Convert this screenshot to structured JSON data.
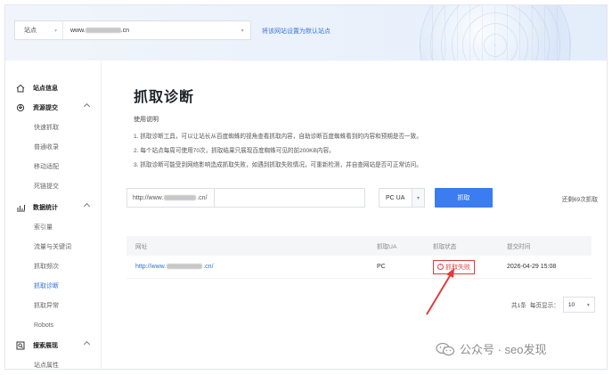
{
  "header": {
    "site_label": "站点",
    "site_url_prefix": "www.",
    "site_url_suffix": ".cn",
    "set_default_link": "将该网站设置为默认站点"
  },
  "sidebar": {
    "groups": [
      {
        "label": "站点信息",
        "icon": "home-icon",
        "items": []
      },
      {
        "label": "资源提交",
        "icon": "upload-icon",
        "items": [
          "快速抓取",
          "普通收录",
          "移动适配",
          "死链提交"
        ]
      },
      {
        "label": "数据统计",
        "icon": "chart-icon",
        "items": [
          "索引量",
          "流量与关键词",
          "抓取频次",
          "抓取诊断",
          "抓取异常",
          "Robots"
        ]
      },
      {
        "label": "搜索展现",
        "icon": "search-display-icon",
        "items": [
          "站点属性"
        ]
      }
    ],
    "active_item": "抓取诊断"
  },
  "main": {
    "title": "抓取诊断",
    "usage_title": "使用说明",
    "usage_lines": [
      "1. 抓取诊断工具，可以让站长从百度蜘蛛的视角查看抓取内容，自助诊断百度蜘蛛看到的内容和预期是否一致。",
      "2. 每个站点每周可使用70次，抓取结果只展现百度蜘蛛可见的前200KB内容。",
      "3. 抓取诊断可能受到网络影响造成抓取失败，如遇到抓取失败情况，可重新检测，并自查网站是否可正常访问。"
    ],
    "url_prefix": "http://www.",
    "url_suffix": ".cn/",
    "url_input_value": "",
    "ua_value": "PC UA",
    "fetch_button": "抓取",
    "remaining_text": "还剩69次抓取"
  },
  "table": {
    "headers": [
      "网址",
      "抓取UA",
      "抓取状态",
      "提交时间"
    ],
    "rows": [
      {
        "url_prefix": "http://www.",
        "url_suffix": ".cn/",
        "ua": "PC",
        "status": "抓取失败",
        "time": "2026-04-29 15:08"
      }
    ]
  },
  "pagination": {
    "total_text": "共1条",
    "per_page_label": "每页显示：",
    "per_page_value": "10"
  },
  "watermark": {
    "text": "公众号 · seo发现"
  },
  "colors": {
    "accent": "#3b7cf0",
    "link": "#2f6fdc",
    "error": "#e0444c",
    "annotation": "#e23b3b"
  }
}
